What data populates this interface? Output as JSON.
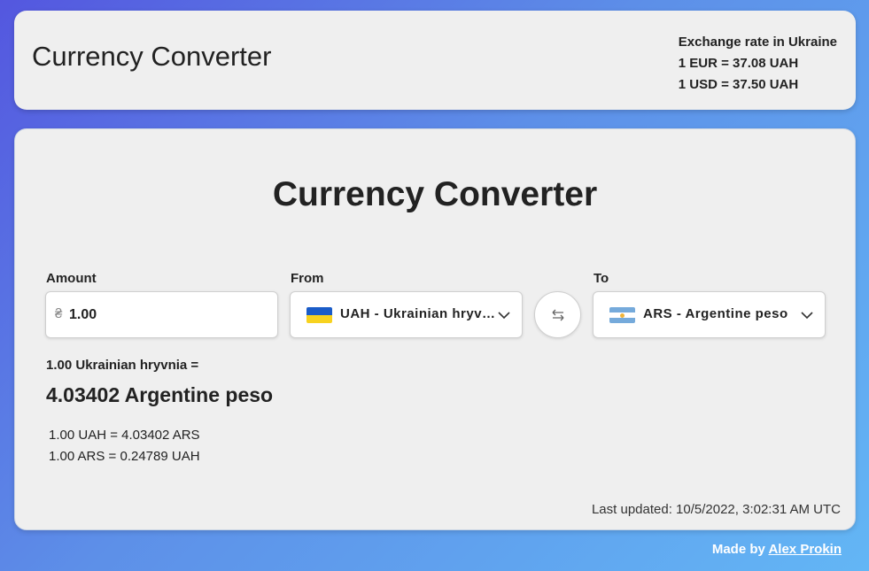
{
  "header": {
    "title": "Currency Converter",
    "rates_heading": "Exchange rate in Ukraine",
    "rate_eur": "1 EUR = 37.08 UAH",
    "rate_usd": "1 USD = 37.50 UAH"
  },
  "converter": {
    "title": "Currency Converter",
    "amount_label": "Amount",
    "amount_symbol": "₴",
    "amount_value": "1.00",
    "from_label": "From",
    "from_value": "UAH - Ukrainian hryvnia",
    "from_flag": "flag-ua-icon",
    "to_label": "To",
    "to_value": "ARS - Argentine peso",
    "to_flag": "flag-ar-icon",
    "swap_icon": "swap-icon",
    "result_label": "1.00 Ukrainian hryvnia =",
    "result_value": "4.03402 Argentine peso",
    "unit_rate_1": "1.00 UAH = 4.03402 ARS",
    "unit_rate_2": "1.00 ARS = 0.24789 UAH",
    "last_updated": "Last updated: 10/5/2022, 3:02:31 AM UTC"
  },
  "footer": {
    "made_by": "Made by",
    "author": "Alex Prokin"
  },
  "colors": {
    "background_start": "#5457df",
    "background_end": "#63b6f5",
    "card": "#efefef",
    "ua_blue": "#1a5cc8",
    "ua_yellow": "#f7d21f",
    "ar_blue": "#75aadb"
  }
}
